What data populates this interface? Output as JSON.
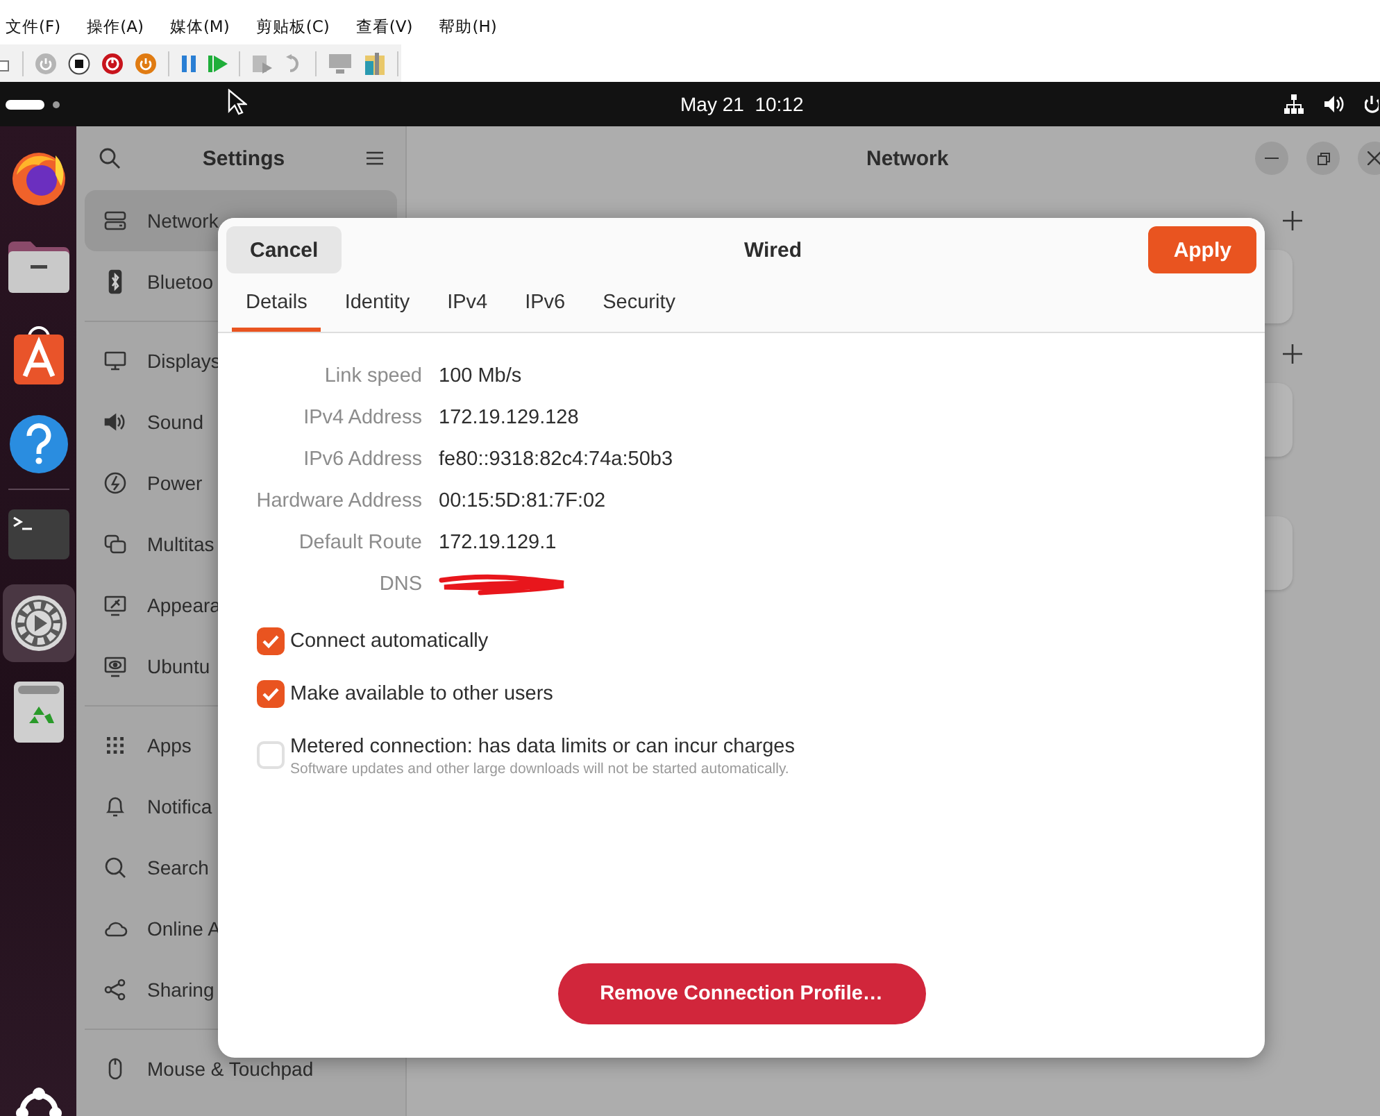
{
  "vm_menu": [
    "文件(F)",
    "操作(A)",
    "媒体(M)",
    "剪贴板(C)",
    "查看(V)",
    "帮助(H)"
  ],
  "top_bar": {
    "clock": "May 21  10:12"
  },
  "dock": [
    {
      "active": false
    },
    {
      "active": false
    },
    {
      "active": false
    },
    {
      "active": false
    },
    {
      "active": false
    },
    {
      "active": true
    },
    {
      "active": false
    }
  ],
  "settings": {
    "title": "Settings",
    "sidebar": [
      [
        {
          "label": "Network",
          "selected": true
        },
        {
          "label": "Bluetoo",
          "selected": false
        }
      ],
      [
        {
          "label": "Displays",
          "selected": false
        },
        {
          "label": "Sound",
          "selected": false
        },
        {
          "label": "Power",
          "selected": false
        },
        {
          "label": "Multitas",
          "selected": false
        },
        {
          "label": "Appeara",
          "selected": false
        },
        {
          "label": "Ubuntu",
          "selected": false
        }
      ],
      [
        {
          "label": "Apps",
          "selected": false
        },
        {
          "label": "Notifica",
          "selected": false
        },
        {
          "label": "Search",
          "selected": false
        },
        {
          "label": "Online A",
          "selected": false
        },
        {
          "label": "Sharing",
          "selected": false
        }
      ],
      [
        {
          "label": "Mouse & Touchpad",
          "selected": false
        }
      ]
    ],
    "page_title": "Network"
  },
  "dialog": {
    "title": "Wired",
    "cancel": "Cancel",
    "apply": "Apply",
    "tabs": [
      {
        "label": "Details",
        "selected": true
      },
      {
        "label": "Identity",
        "selected": false
      },
      {
        "label": "IPv4",
        "selected": false
      },
      {
        "label": "IPv6",
        "selected": false
      },
      {
        "label": "Security",
        "selected": false
      }
    ],
    "details": [
      {
        "label": "Link speed",
        "value": "100 Mb/s"
      },
      {
        "label": "IPv4 Address",
        "value": "172.19.129.128"
      },
      {
        "label": "IPv6 Address",
        "value": "fe80::9318:82c4:74a:50b3"
      },
      {
        "label": "Hardware Address",
        "value": "00:15:5D:81:7F:02"
      },
      {
        "label": "Default Route",
        "value": "172.19.129.1"
      },
      {
        "label": "DNS",
        "redacted": true
      }
    ],
    "options": [
      {
        "label": "Connect automatically",
        "checked": true
      },
      {
        "label": "Make available to other users",
        "checked": true
      },
      {
        "label": "Metered connection: has data limits or can incur charges",
        "hint": "Software updates and other large downloads will not be started automatically.",
        "checked": false
      }
    ],
    "remove": "Remove Connection Profile…"
  }
}
